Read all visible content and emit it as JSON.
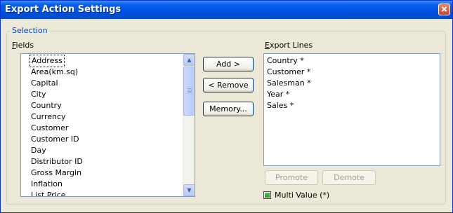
{
  "window": {
    "title": "Export Action Settings"
  },
  "group": {
    "legend": "Selection"
  },
  "fields": {
    "label": "Fields",
    "items": [
      "Address",
      "Area(km.sq)",
      "Capital",
      "City",
      "Country",
      "Currency",
      "Customer",
      "Customer ID",
      "Day",
      "Distributor ID",
      "Gross Margin",
      "Inflation",
      "List Price"
    ]
  },
  "buttons": {
    "add": "Add >",
    "remove": "< Remove",
    "memory": "Memory...",
    "promote": "Promote",
    "demote": "Demote"
  },
  "export_lines": {
    "label": "Export Lines",
    "items": [
      "Country *",
      "Customer *",
      "Salesman *",
      "Year *",
      "Sales *"
    ]
  },
  "multi_value": {
    "label": "Multi Value (*)",
    "checked": true
  },
  "colors": {
    "title_bar": "#0054e3",
    "group_legend": "#0046d5",
    "checkbox_fill": "#21a121"
  }
}
